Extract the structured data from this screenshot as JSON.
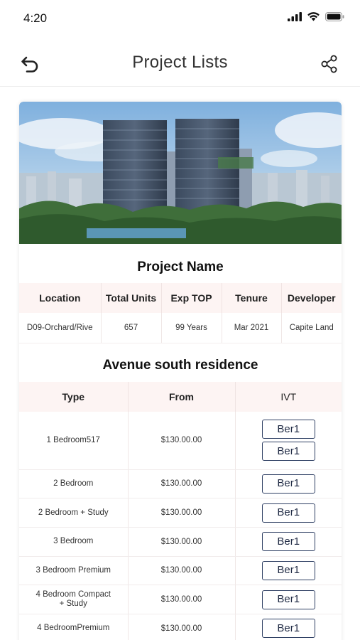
{
  "status": {
    "time": "4:20"
  },
  "nav": {
    "title": "Project Lists"
  },
  "project": {
    "name": "Project Name",
    "headers": [
      "Location",
      "Total Units",
      "Exp TOP",
      "Tenure",
      "Developer"
    ],
    "values": [
      "D09-Orchard/Rive",
      "657",
      "99 Years",
      "Mar 2021",
      "Capite Land"
    ]
  },
  "residence": {
    "title": "Avenue south residence",
    "headers": {
      "type": "Type",
      "from": "From",
      "ivt": "IVT"
    },
    "rows": [
      {
        "type": "1 Bedroom517",
        "from": "$130.00.00",
        "buttons": [
          "Ber1",
          "Ber1"
        ]
      },
      {
        "type": "2 Bedroom",
        "from": "$130.00.00",
        "buttons": [
          "Ber1"
        ]
      },
      {
        "type": "2 Bedroom + Study",
        "from": "$130.00.00",
        "buttons": [
          "Ber1"
        ]
      },
      {
        "type": "3 Bedroom",
        "from": "$130.00.00",
        "buttons": [
          "Ber1"
        ]
      },
      {
        "type": "3 Bedroom Premium",
        "from": "$130.00.00",
        "buttons": [
          "Ber1"
        ]
      },
      {
        "type": "4 Bedroom Compact + Study",
        "from": "$130.00.00",
        "buttons": [
          "Ber1"
        ]
      },
      {
        "type": "4 BedroomPremium",
        "from": "$130.00.00",
        "buttons": [
          "Ber1"
        ]
      }
    ]
  },
  "colors": {
    "header_bg": "#fdf4f3",
    "button_border": "#2e3f63",
    "sky": "#9fc3e4"
  }
}
